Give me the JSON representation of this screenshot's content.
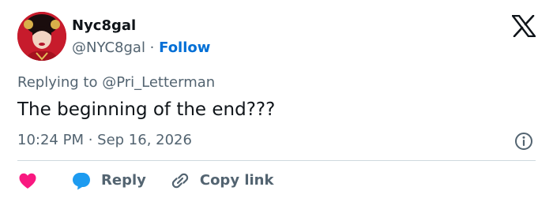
{
  "author": {
    "display_name": "Nyc8gal",
    "handle": "@NYC8gal",
    "separator": " · ",
    "follow_label": "Follow"
  },
  "reply_context": {
    "prefix": "Replying to ",
    "handle": "@Pri_Letterman"
  },
  "tweet": {
    "text": "The beginning of the end???",
    "time": "10:24 PM",
    "time_separator": " · ",
    "date": "Sep 16, 2026"
  },
  "actions": {
    "reply_label": "Reply",
    "copy_link_label": "Copy link"
  },
  "icons": {
    "brand": "x-logo-icon",
    "info": "info-icon",
    "like": "heart-icon",
    "reply": "speech-bubble-icon",
    "copy": "link-icon"
  },
  "colors": {
    "follow": "#006fd6",
    "heart": "#f91880",
    "reply_bubble": "#1d9bf0",
    "secondary_text": "#536471",
    "primary_text": "#0f1419"
  }
}
